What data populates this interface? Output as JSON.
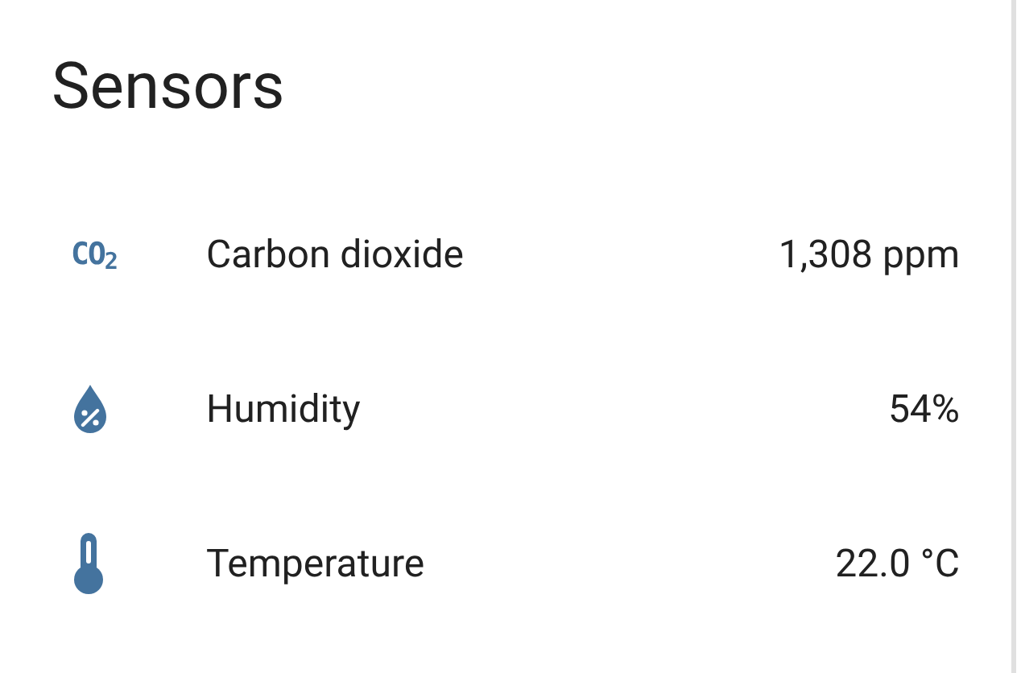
{
  "card": {
    "title": "Sensors",
    "sensors": [
      {
        "kind": "co2",
        "icon_text": "CO$_{2}$",
        "name": "Carbon dioxide",
        "value": "1,308 ppm"
      },
      {
        "kind": "humidity",
        "name": "Humidity",
        "value": "54%"
      },
      {
        "kind": "temperature",
        "name": "Temperature",
        "value": "22.0 °C"
      }
    ]
  }
}
